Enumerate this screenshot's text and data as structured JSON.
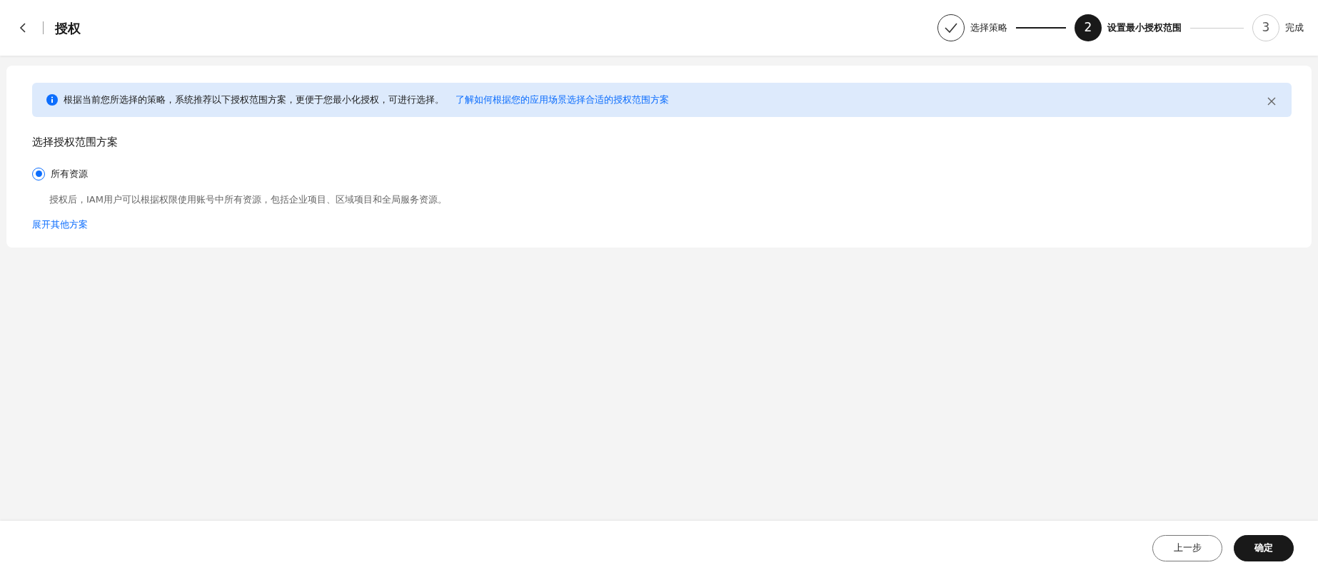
{
  "header": {
    "title": "授权"
  },
  "steps": [
    {
      "label": "选择策略",
      "done": true,
      "selected": false
    },
    {
      "label": "设置最小授权范围",
      "done": false,
      "selected": true,
      "number": "2"
    },
    {
      "label": "完成",
      "done": false,
      "selected": false,
      "number": "3"
    }
  ],
  "alert": {
    "text": "根据当前您所选择的策略，系统推荐以下授权范围方案，更便于您最小化授权，可进行选择。",
    "link": "了解如何根据您的应用场景选择合适的授权范围方案"
  },
  "section_title": "选择授权范围方案",
  "options": [
    {
      "label": "所有资源",
      "selected": true,
      "description": "授权后，IAM用户可以根据权限使用账号中所有资源，包括企业项目、区域项目和全局服务资源。"
    }
  ],
  "expand_link": "展开其他方案",
  "footer": {
    "buttons": [
      {
        "label": "上一步",
        "kind": "secondary"
      },
      {
        "label": "确定",
        "kind": "primary"
      }
    ]
  }
}
